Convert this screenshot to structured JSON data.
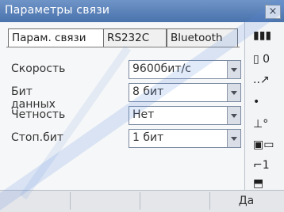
{
  "window": {
    "title": "Параметры связи",
    "close_label": "×"
  },
  "tabs": [
    {
      "label": "Парам. связи"
    },
    {
      "label": "RS232C"
    },
    {
      "label": "Bluetooth"
    }
  ],
  "fields": [
    {
      "label": "Скорость",
      "value": "9600бит/с"
    },
    {
      "label": "Бит данных",
      "value": "8 бит"
    },
    {
      "label": "Четность",
      "value": "Нет"
    },
    {
      "label": "Стоп.бит",
      "value": "1 бит"
    }
  ],
  "right_panel": {
    "items": [
      {
        "label": "▮▮▮",
        "icon": "battery-icon"
      },
      {
        "label": "▯ 0",
        "icon": "status-zero-icon"
      },
      {
        "label": "..↗",
        "icon": "signal-icon"
      },
      {
        "label": "•",
        "icon": "dot-icon"
      },
      {
        "label": "⊥°",
        "icon": "tilt-icon"
      },
      {
        "label": "▣▭",
        "icon": "prism-icon"
      },
      {
        "label": "⌐1",
        "icon": "target-icon"
      },
      {
        "label": "⬒",
        "icon": "keyboard-icon"
      }
    ]
  },
  "softkeys": [
    "",
    "",
    "",
    "Да"
  ]
}
